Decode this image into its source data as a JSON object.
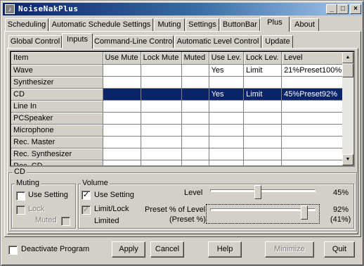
{
  "window": {
    "title": "NoiseNakPlus"
  },
  "titlebar_buttons": {
    "minimize": "_",
    "maximize": "□",
    "close": "×"
  },
  "main_tabs": [
    "Scheduling",
    "Automatic Schedule Settings",
    "Muting",
    "Settings",
    "ButtonBar",
    "Plus",
    "About"
  ],
  "main_tabs_active": "Plus",
  "sub_tabs": [
    "Global Control",
    "Inputs",
    "Command-Line Control",
    "Automatic Level Control",
    "Update"
  ],
  "sub_tabs_active": "Inputs",
  "grid": {
    "columns": [
      "Item",
      "Use Mute",
      "Lock Mute",
      "Muted",
      "Use Lev.",
      "Lock Lev.",
      "Level"
    ],
    "rows": [
      {
        "item": "Wave",
        "use_mute": "",
        "lock_mute": "",
        "muted": "",
        "use_lev": "Yes",
        "lock_lev": "Limit",
        "level": "21%Preset100%"
      },
      {
        "item": "Synthesizer",
        "use_mute": "",
        "lock_mute": "",
        "muted": "",
        "use_lev": "",
        "lock_lev": "",
        "level": ""
      },
      {
        "item": "CD",
        "use_mute": "",
        "lock_mute": "",
        "muted": "",
        "use_lev": "Yes",
        "lock_lev": "Limit",
        "level": "45%Preset92%"
      },
      {
        "item": "Line In",
        "use_mute": "",
        "lock_mute": "",
        "muted": "",
        "use_lev": "",
        "lock_lev": "",
        "level": ""
      },
      {
        "item": "PCSpeaker",
        "use_mute": "",
        "lock_mute": "",
        "muted": "",
        "use_lev": "",
        "lock_lev": "",
        "level": ""
      },
      {
        "item": "Microphone",
        "use_mute": "",
        "lock_mute": "",
        "muted": "",
        "use_lev": "",
        "lock_lev": "",
        "level": ""
      },
      {
        "item": "Rec. Master",
        "use_mute": "",
        "lock_mute": "",
        "muted": "",
        "use_lev": "",
        "lock_lev": "",
        "level": ""
      },
      {
        "item": "Rec. Synthesizer",
        "use_mute": "",
        "lock_mute": "",
        "muted": "",
        "use_lev": "",
        "lock_lev": "",
        "level": ""
      },
      {
        "item": "Rec. CD",
        "use_mute": "",
        "lock_mute": "",
        "muted": "",
        "use_lev": "",
        "lock_lev": "",
        "level": ""
      }
    ],
    "selected_row": "CD"
  },
  "scroll": {
    "up_arrow": "▲",
    "down_arrow": "▼"
  },
  "detail": {
    "group_title": "CD",
    "muting": {
      "title": "Muting",
      "use_setting": "Use Setting",
      "use_setting_checked": "",
      "lock": "Lock",
      "lock_checked": "",
      "muted": "Muted",
      "muted_checked": ""
    },
    "volume": {
      "title": "Volume",
      "use_setting": "Use Setting",
      "use_setting_checked": "✓",
      "limit_lock": "Limit/Lock",
      "limit_lock_checked": "✓",
      "limited": "Limited",
      "level_label": "Level",
      "level_value": "45%",
      "level_fraction": 0.45,
      "preset_label": "Preset % of Level",
      "preset_sub": "(Preset %)",
      "preset_value": "92%",
      "preset_sub_value": "(41%)",
      "preset_fraction": 0.92
    }
  },
  "bottom": {
    "deactivate": "Deactivate Program",
    "deactivate_checked": "",
    "apply": "Apply",
    "cancel": "Cancel",
    "help": "Help",
    "minimize": "Minimize",
    "quit": "Quit"
  }
}
